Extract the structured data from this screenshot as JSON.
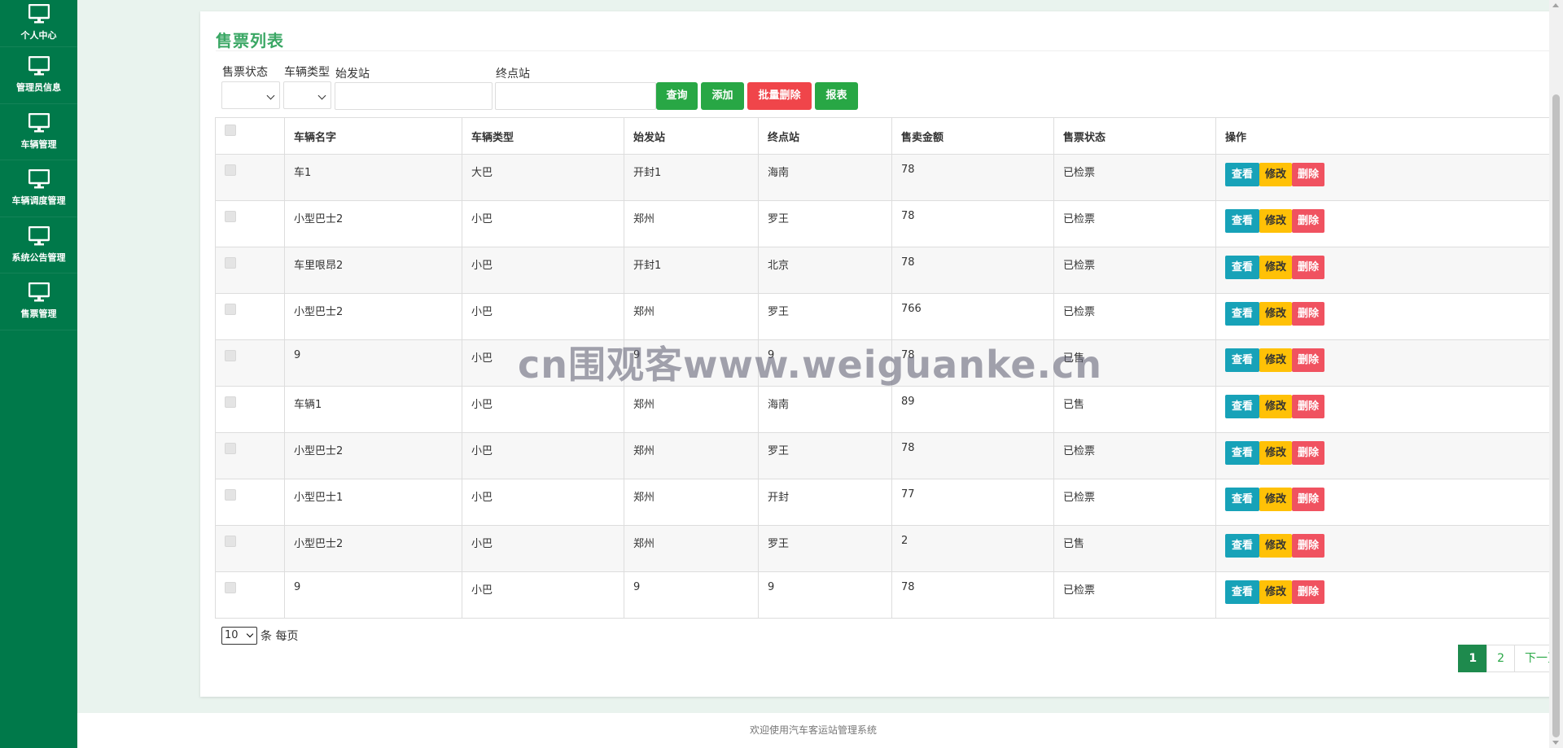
{
  "sidebar": {
    "items": [
      {
        "label": "个人中心",
        "icon": "monitor-icon"
      },
      {
        "label": "管理员信息",
        "icon": "monitor-icon"
      },
      {
        "label": "车辆管理",
        "icon": "monitor-icon"
      },
      {
        "label": "车辆调度管理",
        "icon": "monitor-icon"
      },
      {
        "label": "系统公告管理",
        "icon": "monitor-icon"
      },
      {
        "label": "售票管理",
        "icon": "monitor-icon"
      }
    ]
  },
  "page": {
    "title": "售票列表"
  },
  "filters": {
    "ticket_status_label": "售票状态",
    "vehicle_type_label": "车辆类型",
    "origin_label": "始发站",
    "destination_label": "终点站",
    "ticket_status_value": "",
    "vehicle_type_value": "",
    "origin_value": "",
    "destination_value": ""
  },
  "buttons": {
    "query": "查询",
    "add": "添加",
    "batch_delete": "批量删除",
    "report": "报表"
  },
  "table": {
    "headers": [
      "车辆名字",
      "车辆类型",
      "始发站",
      "终点站",
      "售卖金额",
      "售票状态",
      "操作"
    ],
    "actions": {
      "view": "查看",
      "edit": "修改",
      "delete": "删除"
    },
    "rows": [
      {
        "name": "车1",
        "type": "大巴",
        "origin": "开封1",
        "destination": "海南",
        "amount": "78",
        "status": "已检票"
      },
      {
        "name": "小型巴士2",
        "type": "小巴",
        "origin": "郑州",
        "destination": "罗王",
        "amount": "78",
        "status": "已检票"
      },
      {
        "name": "车里哏昂2",
        "type": "小巴",
        "origin": "开封1",
        "destination": "北京",
        "amount": "78",
        "status": "已检票"
      },
      {
        "name": "小型巴士2",
        "type": "小巴",
        "origin": "郑州",
        "destination": "罗王",
        "amount": "766",
        "status": "已检票"
      },
      {
        "name": "9",
        "type": "小巴",
        "origin": "9",
        "destination": "9",
        "amount": "78",
        "status": "已售"
      },
      {
        "name": "车辆1",
        "type": "小巴",
        "origin": "郑州",
        "destination": "海南",
        "amount": "89",
        "status": "已售"
      },
      {
        "name": "小型巴士2",
        "type": "小巴",
        "origin": "郑州",
        "destination": "罗王",
        "amount": "78",
        "status": "已检票"
      },
      {
        "name": "小型巴士1",
        "type": "小巴",
        "origin": "郑州",
        "destination": "开封",
        "amount": "77",
        "status": "已检票"
      },
      {
        "name": "小型巴士2",
        "type": "小巴",
        "origin": "郑州",
        "destination": "罗王",
        "amount": "2",
        "status": "已售"
      },
      {
        "name": "9",
        "type": "小巴",
        "origin": "9",
        "destination": "9",
        "amount": "78",
        "status": "已检票"
      }
    ]
  },
  "pagination": {
    "per_page_value": "10",
    "per_page_suffix": "条 每页",
    "pages": [
      "1",
      "2"
    ],
    "current_page": "1",
    "next": "下一页"
  },
  "footer": {
    "text": "欢迎使用汽车客运站管理系统"
  },
  "watermark": {
    "text": "cn围观客www.weiguanke.cn"
  },
  "colors": {
    "sidebar": "#00794a",
    "title": "#3aa764",
    "primary": "#28a745",
    "danger": "#f0454a",
    "info": "#17a2b8",
    "warning": "#ffc107"
  }
}
